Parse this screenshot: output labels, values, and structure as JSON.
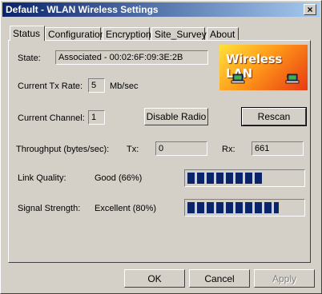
{
  "window": {
    "title": "Default - WLAN Wireless Settings",
    "close_label": "×"
  },
  "tabs": [
    {
      "label": "Status",
      "active": true
    },
    {
      "label": "Configuration",
      "active": false
    },
    {
      "label": "Encryption",
      "active": false
    },
    {
      "label": "Site_Survey",
      "active": false
    },
    {
      "label": "About",
      "active": false
    }
  ],
  "banner": {
    "text": "Wireless LAN",
    "icons": [
      "laptop-icon",
      "laptop-icon"
    ]
  },
  "status": {
    "state_label": "State:",
    "state_value": "Associated - 00:02:6F:09:3E:2B",
    "tx_rate_label": "Current Tx Rate:",
    "tx_rate_value": "5",
    "tx_rate_unit": "Mb/sec",
    "channel_label": "Current Channel:",
    "channel_value": "1",
    "disable_radio_label": "Disable Radio",
    "rescan_label": "Rescan",
    "throughput_label": "Throughput (bytes/sec):",
    "tx_label": "Tx:",
    "tx_value": "0",
    "rx_label": "Rx:",
    "rx_value": "661",
    "link_quality_label": "Link Quality:",
    "link_quality_text": "Good (66%)",
    "link_quality_percent": 66,
    "signal_label": "Signal Strength:",
    "signal_text": "Excellent (80%)",
    "signal_percent": 80
  },
  "buttons": {
    "ok": "OK",
    "cancel": "Cancel",
    "apply": "Apply"
  },
  "colors": {
    "title_start": "#0a246a",
    "title_end": "#a6caf0",
    "meter": "#0a246a",
    "face": "#d4d0c8"
  }
}
